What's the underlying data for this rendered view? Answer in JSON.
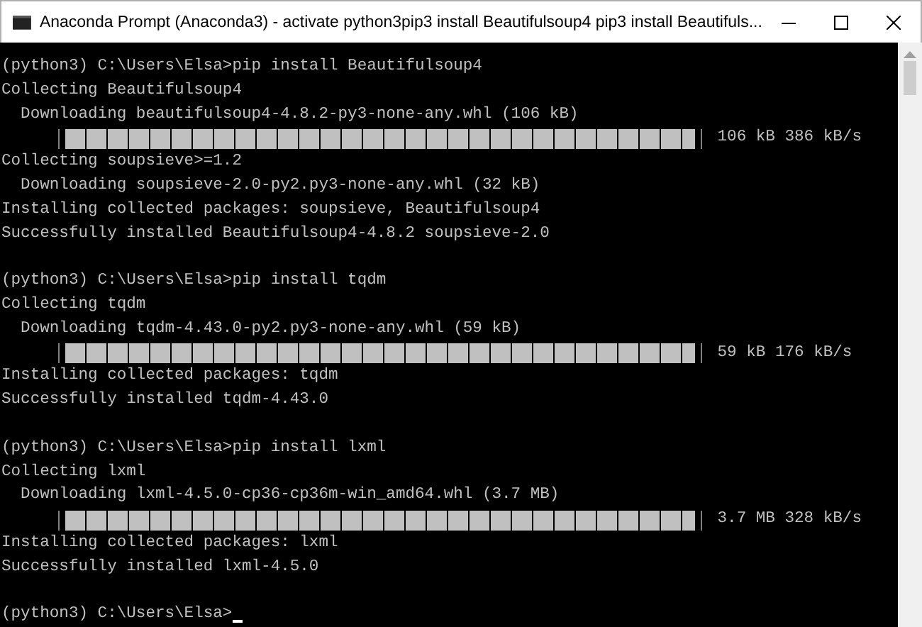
{
  "window": {
    "title": "Anaconda Prompt (Anaconda3) - activate  python3pip3 install Beautifulsoup4 pip3 install Beautifuls..."
  },
  "console": {
    "lines": [
      {
        "kind": "text",
        "text": "(python3) C:\\Users\\Elsa>pip install Beautifulsoup4"
      },
      {
        "kind": "text",
        "text": "Collecting Beautifulsoup4"
      },
      {
        "kind": "text",
        "text": "  Downloading beautifulsoup4-4.8.2-py3-none-any.whl (106 kB)"
      },
      {
        "kind": "progress",
        "level": 1,
        "reading": "106 kB 386 kB/s"
      },
      {
        "kind": "text",
        "text": "Collecting soupsieve>=1.2"
      },
      {
        "kind": "text",
        "text": "  Downloading soupsieve-2.0-py2.py3-none-any.whl (32 kB)"
      },
      {
        "kind": "text",
        "text": "Installing collected packages: soupsieve, Beautifulsoup4"
      },
      {
        "kind": "text",
        "text": "Successfully installed Beautifulsoup4-4.8.2 soupsieve-2.0"
      },
      {
        "kind": "blank"
      },
      {
        "kind": "text",
        "text": "(python3) C:\\Users\\Elsa>pip install tqdm"
      },
      {
        "kind": "text",
        "text": "Collecting tqdm"
      },
      {
        "kind": "text",
        "text": "  Downloading tqdm-4.43.0-py2.py3-none-any.whl (59 kB)"
      },
      {
        "kind": "progress",
        "level": 1,
        "reading": "59 kB 176 kB/s"
      },
      {
        "kind": "text",
        "text": "Installing collected packages: tqdm"
      },
      {
        "kind": "text",
        "text": "Successfully installed tqdm-4.43.0"
      },
      {
        "kind": "blank"
      },
      {
        "kind": "text",
        "text": "(python3) C:\\Users\\Elsa>pip install lxml"
      },
      {
        "kind": "text",
        "text": "Collecting lxml"
      },
      {
        "kind": "text",
        "text": "  Downloading lxml-4.5.0-cp36-cp36m-win_amd64.whl (3.7 MB)"
      },
      {
        "kind": "progress",
        "level": 1,
        "reading": "3.7 MB 328 kB/s"
      },
      {
        "kind": "text",
        "text": "Installing collected packages: lxml"
      },
      {
        "kind": "text",
        "text": "Successfully installed lxml-4.5.0"
      },
      {
        "kind": "blank"
      },
      {
        "kind": "prompt",
        "text": "(python3) C:\\Users\\Elsa>"
      }
    ]
  }
}
